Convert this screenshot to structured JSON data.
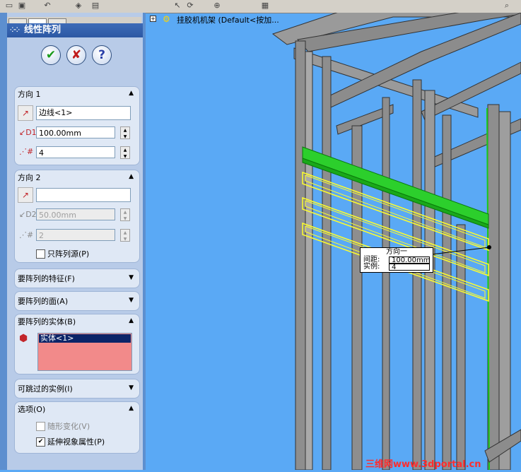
{
  "toolbar": {
    "icons": [
      "save-icon",
      "print-icon",
      "undo-icon",
      "select-icon",
      "zoom-icon",
      "rotate-icon",
      "view-icon",
      "rebuild-icon",
      "options-icon"
    ]
  },
  "panel": {
    "tabs": [
      "feature-manager-tab",
      "property-manager-tab",
      "configuration-manager-tab"
    ],
    "title": "线性阵列",
    "buttons": {
      "ok": "✔",
      "cancel": "✘",
      "help": "?"
    },
    "direction1": {
      "header": "方向 1",
      "edge_value": "边线<1>",
      "spacing_value": "100.00mm",
      "instances_value": "4"
    },
    "direction2": {
      "header": "方向 2",
      "edge_value": "",
      "spacing_value": "50.00mm",
      "instances_value": "2",
      "seed_only_label": "只阵列源(P)"
    },
    "features_header": "要阵列的特征(F)",
    "faces_header": "要阵列的面(A)",
    "bodies": {
      "header": "要阵列的实体(B)",
      "items": [
        "实体<1>"
      ]
    },
    "skip_header": "可跳过的实例(I)",
    "options": {
      "header": "选项(O)",
      "vary_sketch_label": "随形变化(V)",
      "vary_sketch_checked": false,
      "propagate_label": "延伸视象属性(P)",
      "propagate_checked": true
    }
  },
  "viewport": {
    "tree_label": "挂胶机机架 (Default<按加...",
    "callout": {
      "title": "方向一",
      "spacing_label": "间距:",
      "spacing_value": "100.00mm",
      "instances_label": "实例:",
      "instances_value": "4"
    },
    "watermark": "三维网www.3dportal.cn"
  }
}
